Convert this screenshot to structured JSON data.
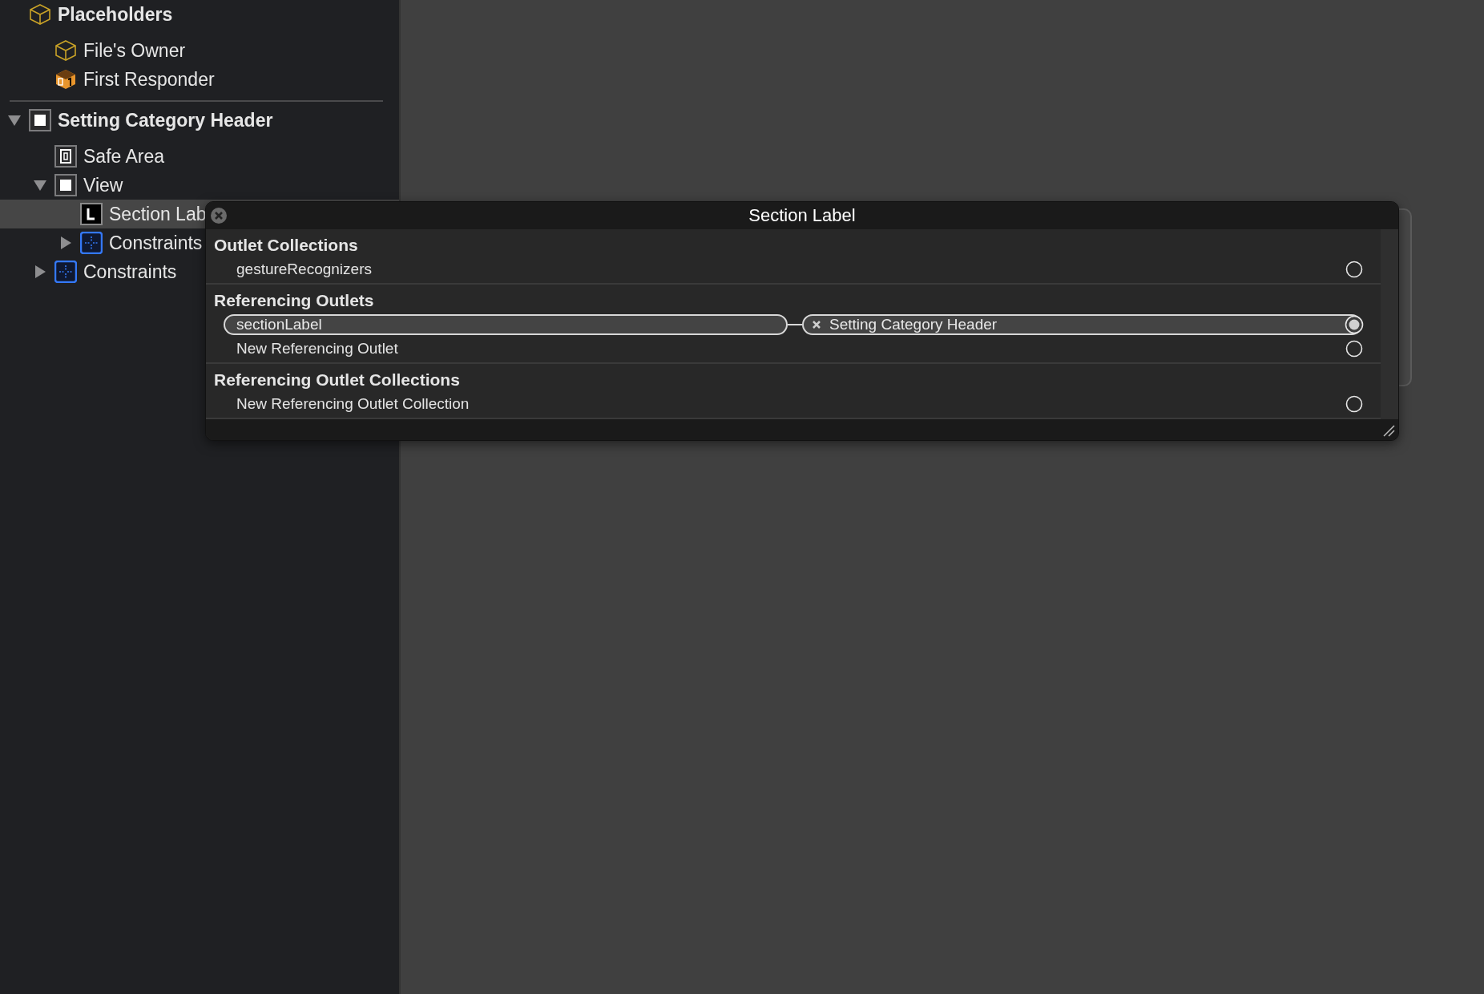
{
  "outline": [
    {
      "label": "Placeholders",
      "kind": "placeholder",
      "bold": true,
      "children": [
        {
          "label": "File's Owner",
          "kind": "placeholder"
        },
        {
          "label": "First Responder",
          "kind": "responder"
        }
      ]
    },
    {
      "label": "Setting Category Header",
      "kind": "view",
      "bold": true,
      "expanded": true,
      "children": [
        {
          "label": "Safe Area",
          "kind": "safe-area"
        },
        {
          "label": "View",
          "kind": "view",
          "expanded": true,
          "children": [
            {
              "label": "Section Lab",
              "kind": "label",
              "selected": true
            },
            {
              "label": "Constraints",
              "kind": "constraints",
              "expanded": false
            }
          ]
        },
        {
          "label": "Constraints",
          "kind": "constraints",
          "expanded": false
        }
      ]
    }
  ],
  "popup": {
    "title": "Section Label",
    "sections": [
      {
        "heading": "Outlet Collections",
        "rows": [
          {
            "kind": "slot",
            "label": "gestureRecognizers"
          }
        ]
      },
      {
        "heading": "Referencing Outlets",
        "rows": [
          {
            "kind": "connection",
            "label": "sectionLabel",
            "target": "Setting Category Header"
          },
          {
            "kind": "slot",
            "label": "New Referencing Outlet"
          }
        ]
      },
      {
        "heading": "Referencing Outlet Collections",
        "rows": [
          {
            "kind": "slot",
            "label": "New Referencing Outlet Collection"
          }
        ]
      }
    ]
  }
}
